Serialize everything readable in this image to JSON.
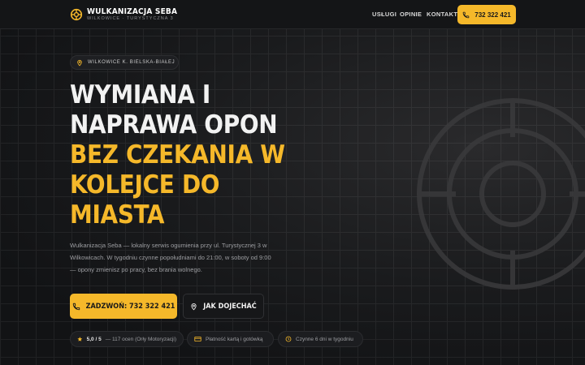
{
  "header": {
    "brand_title": "WULKANIZACJA SEBA",
    "brand_subtitle": "WILKOWICE · TURYSTYCZNA 3",
    "nav": [
      "USŁUGI",
      "OPINIE",
      "KONTAKT"
    ],
    "phone": "732 322 421"
  },
  "hero": {
    "location": "WILKOWICE K. BIELSKA-BIAŁEJ",
    "title_line1": "WYMIANA I",
    "title_line2": "NAPRAWA OPON",
    "title_accent1": "BEZ CZEKANIA W",
    "title_accent2": "KOLEJCE DO",
    "title_accent3": "MIASTA",
    "description": "Wulkanizacja Seba — lokalny serwis ogumienia przy ul. Turystycznej 3 w Wilkowicach. W tygodniu czynne popołudniami do 21:00, w soboty od 9:00 — opony zmienisz po pracy, bez brania wolnego.",
    "cta_call": "ZADZWOŃ: 732 322 421",
    "cta_directions": "JAK DOJECHAĆ"
  },
  "badges": {
    "rating_value": "5,0 / 5",
    "rating_text": "— 117 ocen (Orły Motoryzacji)",
    "payment": "Płatność kartą i gotówką",
    "hours": "Czynne 6 dni w tygodniu"
  },
  "colors": {
    "accent": "#f5b82a",
    "background": "#121315"
  },
  "icons": [
    "gear-logo-icon",
    "phone-icon",
    "map-pin-icon",
    "star-icon",
    "card-icon",
    "clock-icon",
    "wheel-decoration"
  ]
}
